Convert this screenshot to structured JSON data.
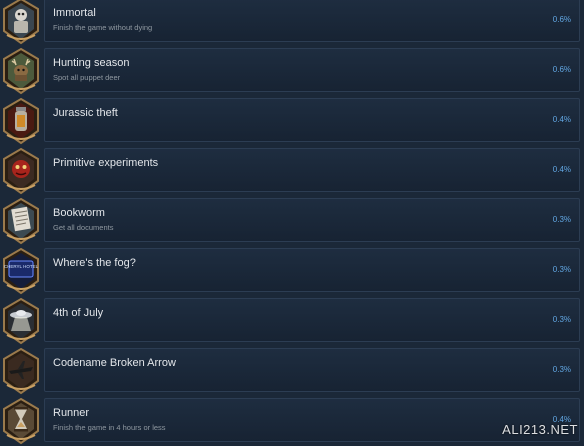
{
  "achievements": [
    {
      "title": "Immortal",
      "description": "Finish the game without dying",
      "percent": "0.6%",
      "icon": "skeleton-armor-icon"
    },
    {
      "title": "Hunting season",
      "description": "Spot all puppet deer",
      "percent": "0.6%",
      "icon": "puppet-deer-icon"
    },
    {
      "title": "Jurassic theft",
      "description": "",
      "percent": "0.4%",
      "icon": "amber-vial-icon"
    },
    {
      "title": "Primitive experiments",
      "description": "",
      "percent": "0.4%",
      "icon": "red-creature-icon"
    },
    {
      "title": "Bookworm",
      "description": "Get all documents",
      "percent": "0.3%",
      "icon": "document-icon"
    },
    {
      "title": "Where's the fog?",
      "description": "",
      "percent": "0.3%",
      "icon": "cheryl-hotel-sign-icon"
    },
    {
      "title": "4th of July",
      "description": "",
      "percent": "0.3%",
      "icon": "ufo-icon"
    },
    {
      "title": "Codename Broken Arrow",
      "description": "",
      "percent": "0.3%",
      "icon": "bomber-plane-icon"
    },
    {
      "title": "Runner",
      "description": "Finish the game in 4 hours or less",
      "percent": "0.4%",
      "icon": "hourglass-icon"
    }
  ],
  "icon_text": {
    "cheryl_hotel": "CHERYL HOTEL"
  },
  "watermark": "ALI213.NET",
  "colors": {
    "background": "#1b2838",
    "card_border": "#2c3d53",
    "title": "#e3e6ea",
    "description": "#8f98a0",
    "percent": "#62a7e3",
    "badge_frame": "#9a7a4c"
  }
}
